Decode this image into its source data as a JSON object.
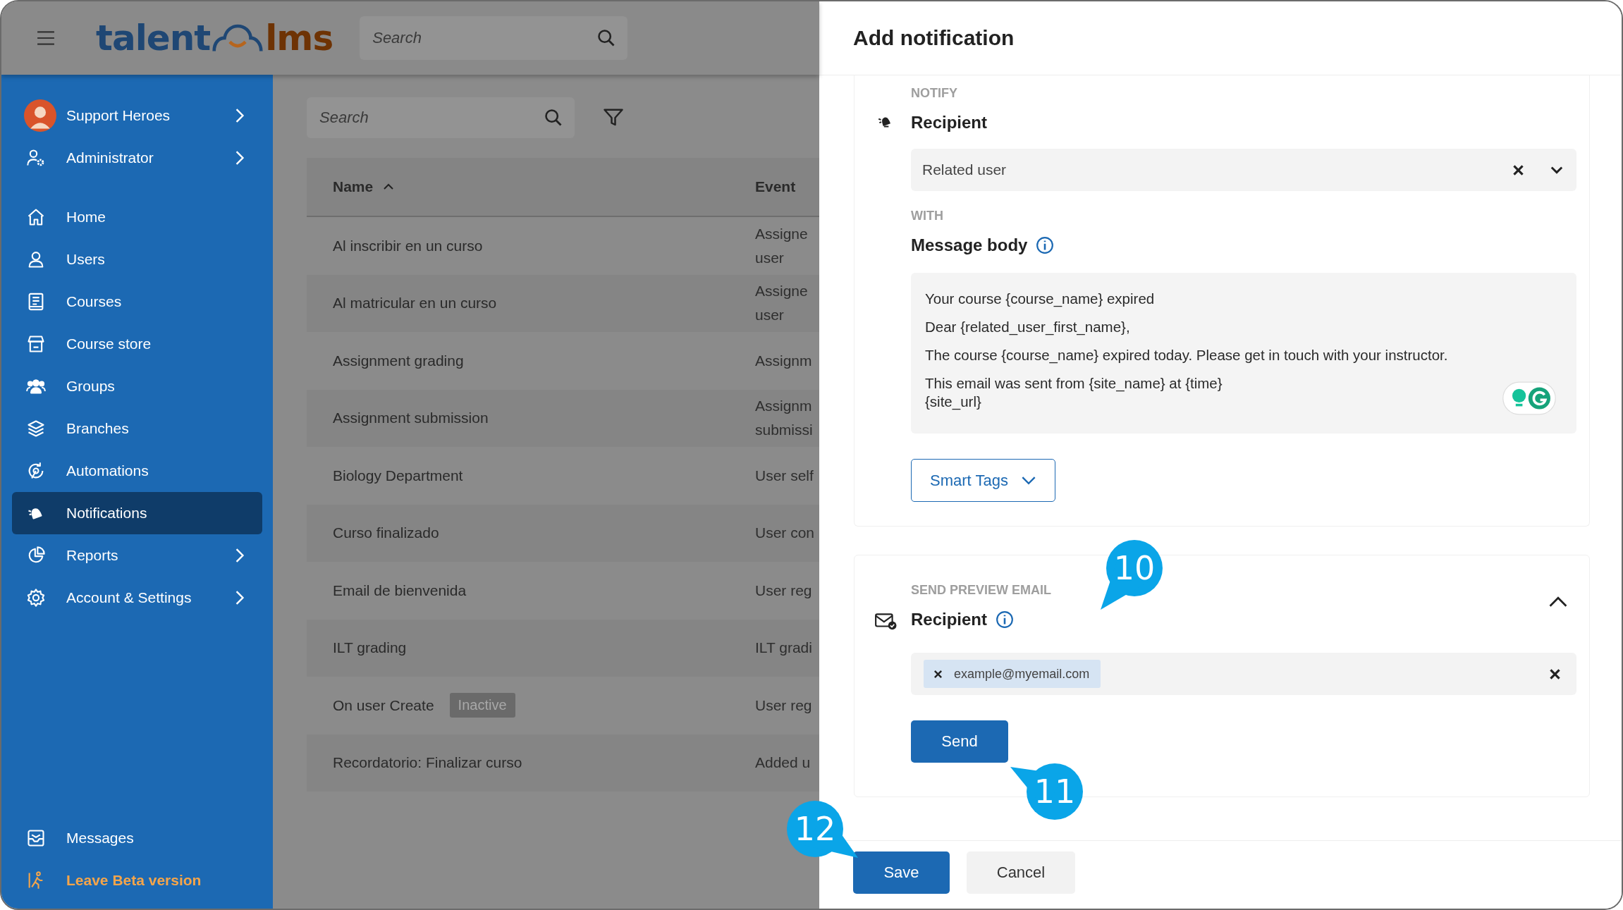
{
  "header": {
    "logo": {
      "left": "talent",
      "right": "lms"
    },
    "search": {
      "placeholder": "Search"
    }
  },
  "sidebar": {
    "account": {
      "name": "Support Heroes",
      "has_children": true
    },
    "role": {
      "label": "Administrator",
      "has_children": true
    },
    "items": [
      {
        "label": "Home",
        "selected": false,
        "has_children": false
      },
      {
        "label": "Users",
        "selected": false,
        "has_children": false
      },
      {
        "label": "Courses",
        "selected": false,
        "has_children": false
      },
      {
        "label": "Course store",
        "selected": false,
        "has_children": false
      },
      {
        "label": "Groups",
        "selected": false,
        "has_children": false
      },
      {
        "label": "Branches",
        "selected": false,
        "has_children": false
      },
      {
        "label": "Automations",
        "selected": false,
        "has_children": false
      },
      {
        "label": "Notifications",
        "selected": true,
        "has_children": false
      },
      {
        "label": "Reports",
        "selected": false,
        "has_children": true
      },
      {
        "label": "Account & Settings",
        "selected": false,
        "has_children": true
      }
    ],
    "bottom": [
      {
        "label": "Messages",
        "kind": "link"
      },
      {
        "label": "Leave Beta version",
        "kind": "highlight"
      }
    ]
  },
  "list": {
    "search": {
      "placeholder": "Search"
    },
    "columns": [
      {
        "label": "Name",
        "sorted": true
      },
      {
        "label": "Event",
        "sorted": false
      }
    ],
    "rows": [
      {
        "name": "Al inscribir en un curso",
        "event": "Assigne\nuser"
      },
      {
        "name": "Al matricular en un curso",
        "event": "Assigne\nuser"
      },
      {
        "name": "Assignment grading",
        "event": "Assignm"
      },
      {
        "name": "Assignment submission",
        "event": "Assignm\nsubmissi"
      },
      {
        "name": "Biology Department",
        "event": "User self"
      },
      {
        "name": "Curso finalizado",
        "event": "User con"
      },
      {
        "name": "Email de bienvenida",
        "event": "User reg"
      },
      {
        "name": "ILT grading",
        "event": "ILT gradi"
      },
      {
        "name": "On user Create",
        "badge": "Inactive",
        "event": "User reg"
      },
      {
        "name": "Recordatorio: Finalizar curso",
        "event": "Added u"
      }
    ]
  },
  "panel": {
    "title": "Add notification",
    "notify": {
      "section": "NOTIFY",
      "label": "Recipient",
      "value": "Related user"
    },
    "with": {
      "section": "WITH",
      "label": "Message body",
      "paragraphs": [
        [
          "Your course {course_name} expired"
        ],
        [
          "Dear {related_user_first_name},"
        ],
        [
          "The course {course_name} expired today. Please get in touch with your instructor."
        ],
        [
          "This email was sent from {site_name} at {time}",
          "{site_url}"
        ]
      ],
      "smart_tags": "Smart Tags"
    },
    "preview": {
      "section": "SEND PREVIEW EMAIL",
      "label": "Recipient",
      "expanded": true,
      "tags": [
        "example@myemail.com"
      ],
      "button": "Send"
    },
    "buttons": [
      {
        "label": "Save",
        "kind": "primary"
      },
      {
        "label": "Cancel",
        "kind": "secondary"
      }
    ]
  },
  "callouts": [
    "10",
    "11",
    "12"
  ]
}
